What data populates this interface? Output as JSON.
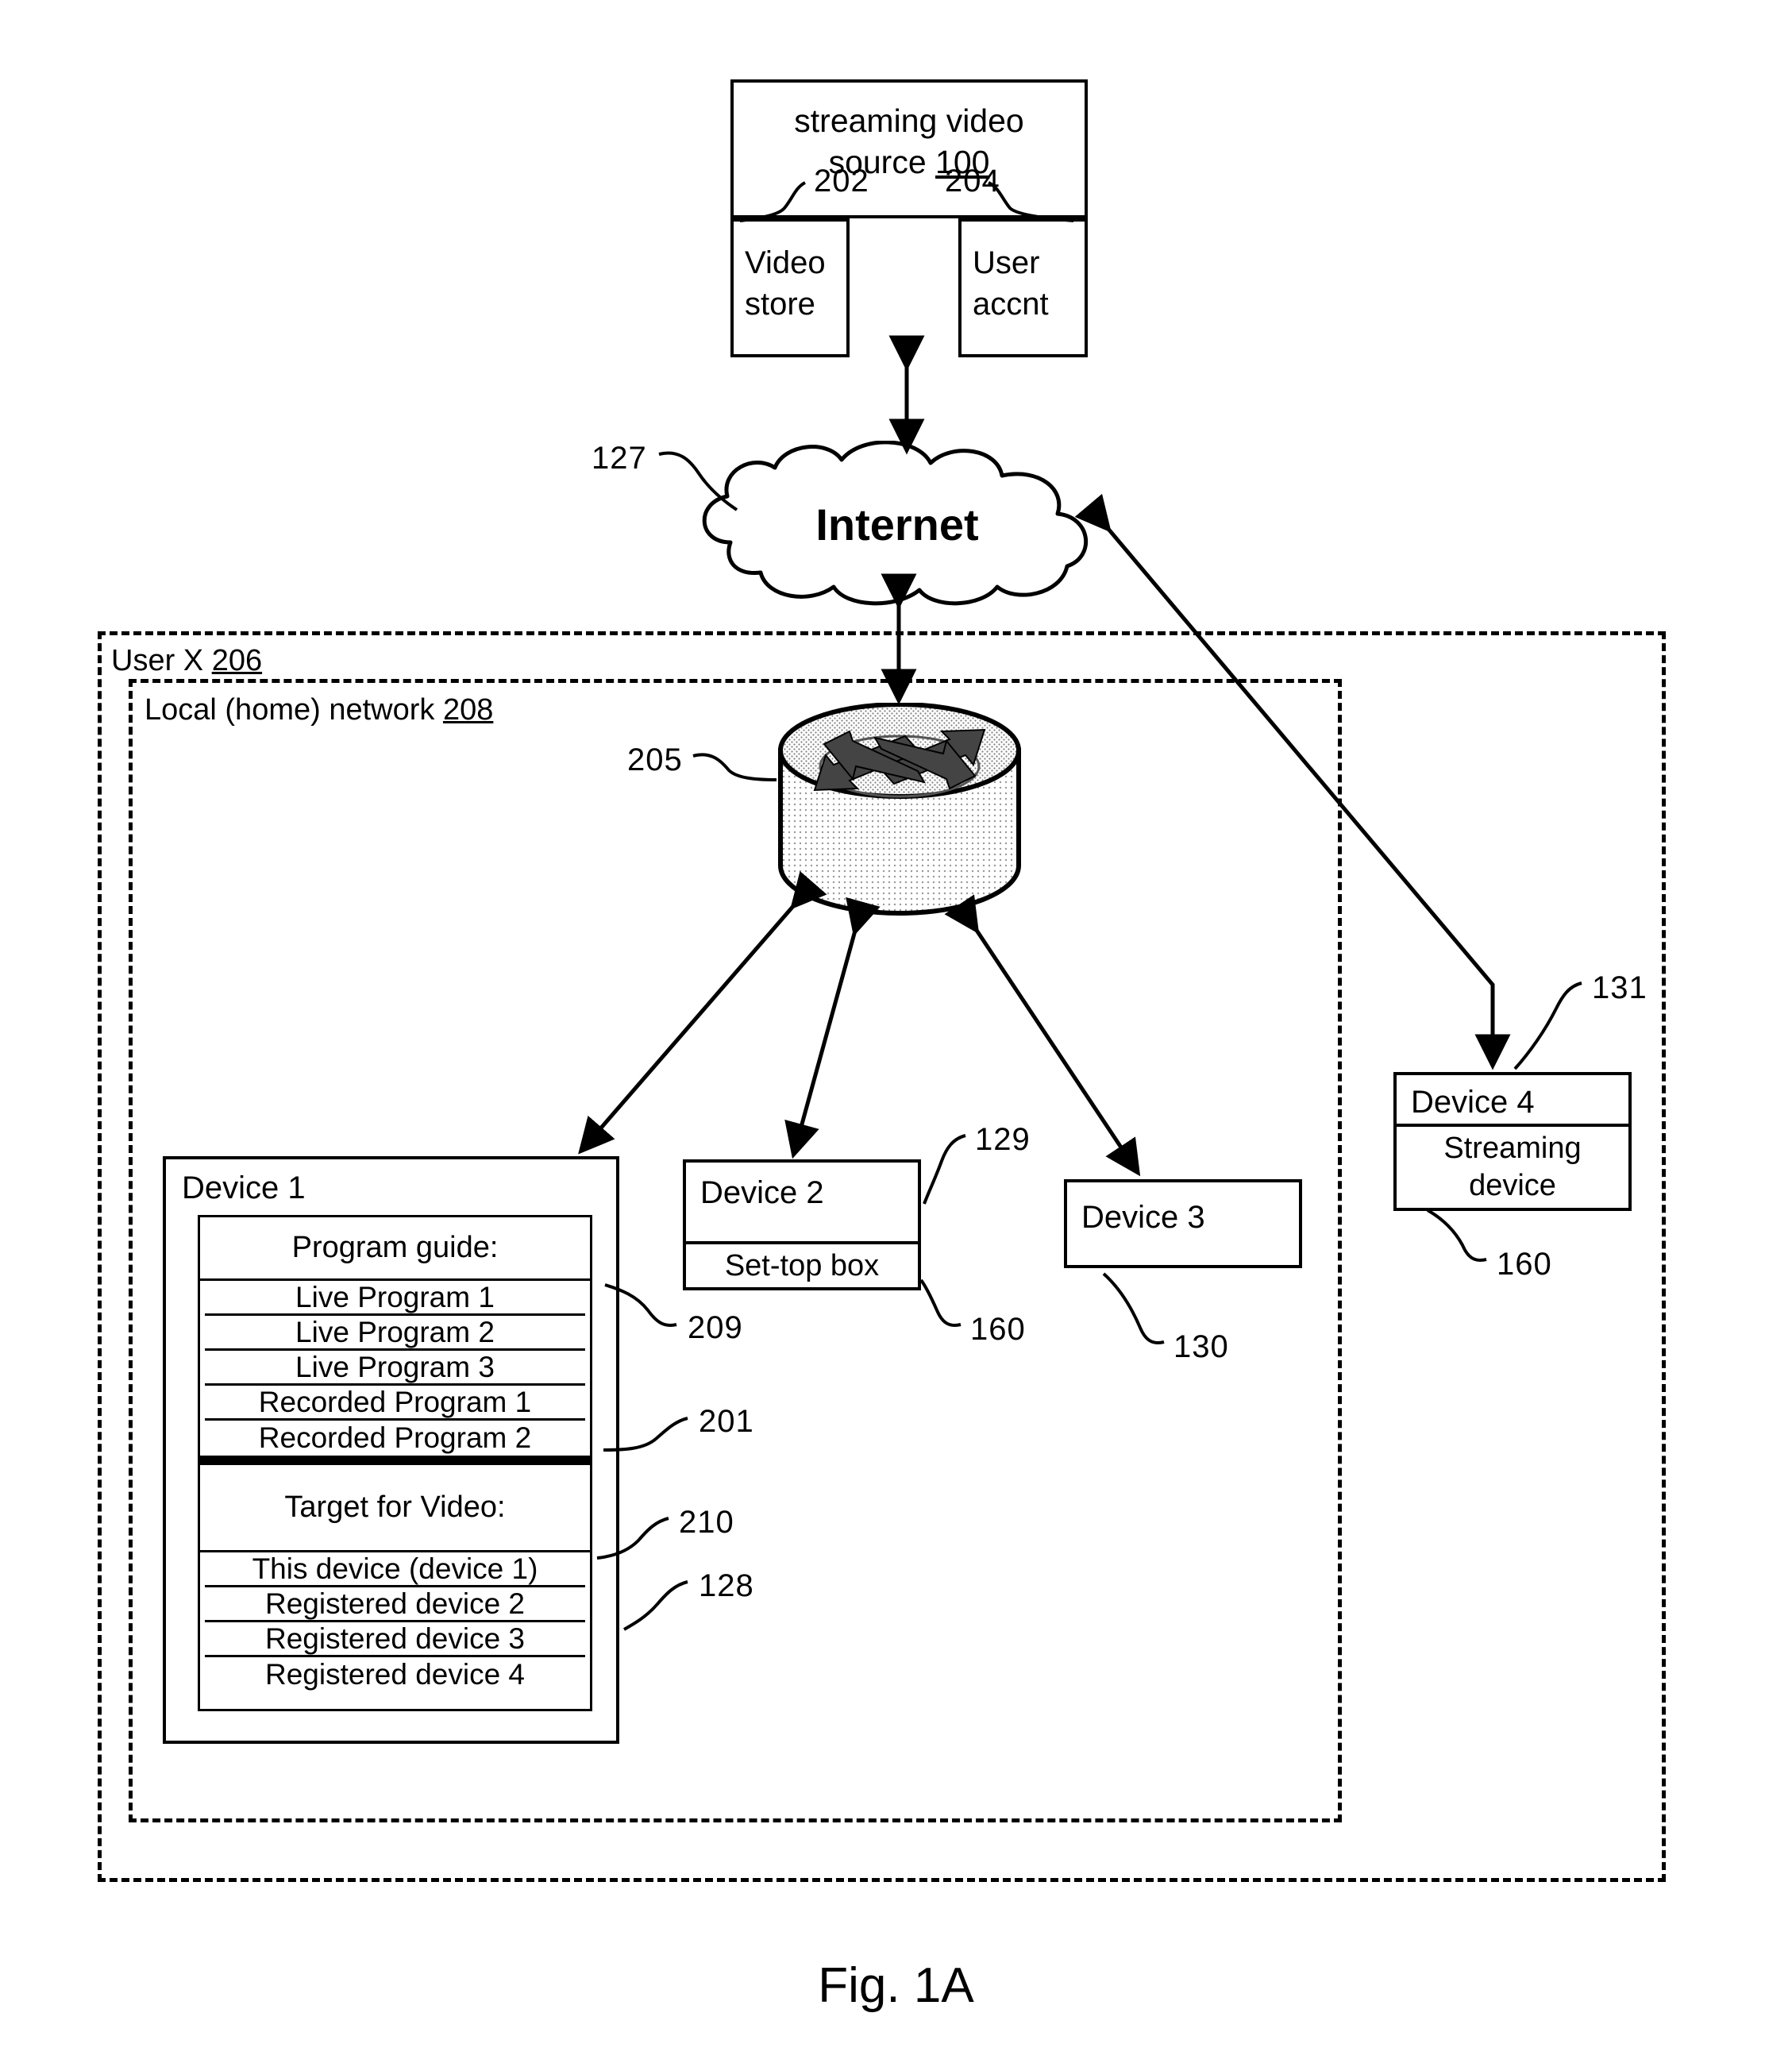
{
  "figure": {
    "caption": "Fig. 1A"
  },
  "source": {
    "title_line1": "streaming video",
    "title_line2_text": "source ",
    "title_line2_num": "100",
    "ref_video_store": "202",
    "ref_user_accnt": "204",
    "video_store": "Video\nstore",
    "video_store_line1": "Video",
    "video_store_line2": "store",
    "user_accnt_line1": "User",
    "user_accnt_line2": "accnt"
  },
  "cloud": {
    "label": "Internet",
    "ref": "127"
  },
  "userx": {
    "text": "User X ",
    "num": "206"
  },
  "localnet": {
    "text": "Local (home) network ",
    "num": "208"
  },
  "router": {
    "ref": "205"
  },
  "device1": {
    "title": "Device 1",
    "ref_panel": "209",
    "ref_programs": "201",
    "ref_target": "210",
    "ref_box": "128",
    "program_guide_header": "Program guide:",
    "programs": [
      "Live Program 1",
      "Live Program 2",
      "Live Program 3",
      "Recorded Program 1",
      "Recorded Program 2"
    ],
    "target_header": "Target for Video:",
    "targets": [
      "This device (device 1)",
      "Registered device 2",
      "Registered device 3",
      "Registered device 4"
    ]
  },
  "device2": {
    "title": "Device 2",
    "subtitle": "Set-top box",
    "ref_box": "129",
    "ref_sub": "160"
  },
  "device3": {
    "title": "Device 3",
    "ref_box": "130"
  },
  "device4": {
    "title": "Device 4",
    "subtitle_line1": "Streaming",
    "subtitle_line2": "device",
    "ref_box": "131",
    "ref_sub": "160"
  },
  "colors": {
    "ink": "#000000",
    "paper": "#ffffff",
    "router_fill": "#d9d9d9"
  }
}
